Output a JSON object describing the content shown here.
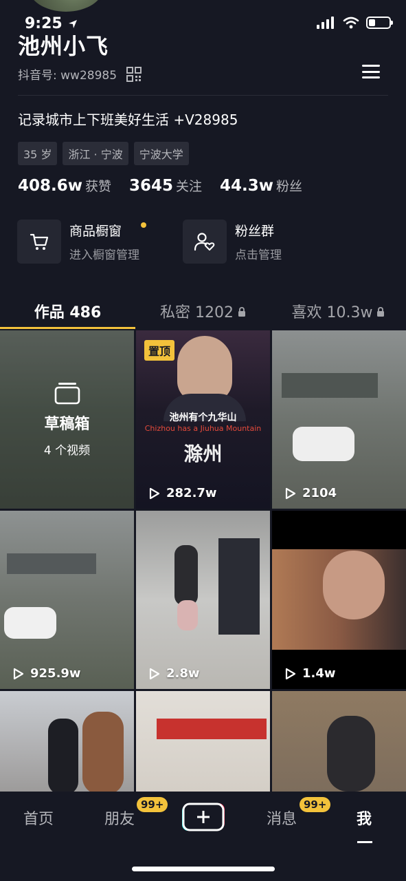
{
  "status_bar": {
    "time": "9:25"
  },
  "profile": {
    "name": "池州小飞",
    "douyin_id_label": "抖音号: ww28985",
    "bio": "记录城市上下班美好生活 +V28985",
    "tags": [
      "35 岁",
      "浙江 · 宁波",
      "宁波大学"
    ],
    "stats": [
      {
        "num": "408.6w",
        "label": "获赞"
      },
      {
        "num": "3645",
        "label": "关注"
      },
      {
        "num": "44.3w",
        "label": "粉丝"
      }
    ]
  },
  "features": {
    "shop": {
      "title": "商品橱窗",
      "sub": "进入橱窗管理"
    },
    "fans": {
      "title": "粉丝群",
      "sub": "点击管理"
    }
  },
  "tabs": [
    {
      "label": "作品 486",
      "locked": false
    },
    {
      "label": "私密 1202",
      "locked": true
    },
    {
      "label": "喜欢 10.3w",
      "locked": true
    }
  ],
  "drafts": {
    "title": "草稿箱",
    "count": "4 个视频"
  },
  "videos": [
    {
      "plays": "282.7w",
      "pinned": "置顶",
      "overlay_text": "池州有个九华山",
      "overlay_en": "Chizhou has a Jiuhua Mountain",
      "overlay_big": "滁州"
    },
    {
      "plays": "2104"
    },
    {
      "plays": "925.9w"
    },
    {
      "plays": "2.8w"
    },
    {
      "plays": "1.4w"
    }
  ],
  "bottom_nav": {
    "home": "首页",
    "friends": "朋友",
    "friends_badge": "99+",
    "messages": "消息",
    "messages_badge": "99+",
    "me": "我"
  },
  "colors": {
    "accent": "#f3c23b",
    "background": "#161823"
  }
}
